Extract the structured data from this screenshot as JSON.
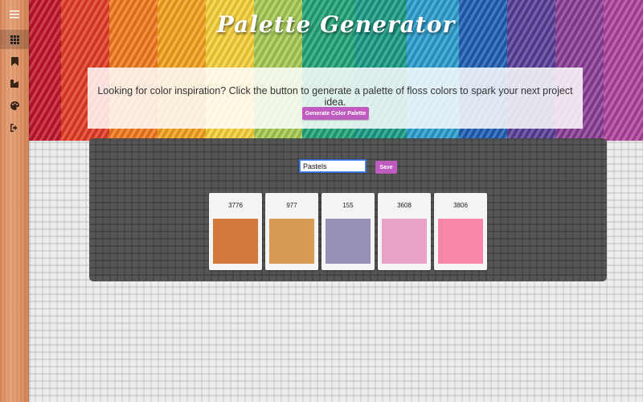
{
  "app": {
    "title": "Palette Generator"
  },
  "sidebar": {
    "items": [
      {
        "icon": "menu-icon",
        "active": false
      },
      {
        "icon": "grid-icon",
        "active": true
      },
      {
        "icon": "bookmark-icon",
        "active": false
      },
      {
        "icon": "shapes-icon",
        "active": false
      },
      {
        "icon": "palette-icon",
        "active": false
      },
      {
        "icon": "logout-icon",
        "active": false
      }
    ]
  },
  "intro": {
    "text": "Looking for color inspiration? Click the button to generate a palette of floss colors to spark your next project idea.",
    "generate_label": "Generate Color Palette"
  },
  "palette": {
    "name_value": "Pastels",
    "save_label": "Save",
    "swatches": [
      {
        "code": "3776",
        "color": "#d17a3c"
      },
      {
        "code": "977",
        "color": "#d99b54"
      },
      {
        "code": "155",
        "color": "#9691b5"
      },
      {
        "code": "3608",
        "color": "#e9a3c9"
      },
      {
        "code": "3806",
        "color": "#f986a8"
      }
    ]
  },
  "colors": {
    "accent": "#c05bc0",
    "sidebar_wood": "#dd9263",
    "panel": "#4e4e4e"
  }
}
